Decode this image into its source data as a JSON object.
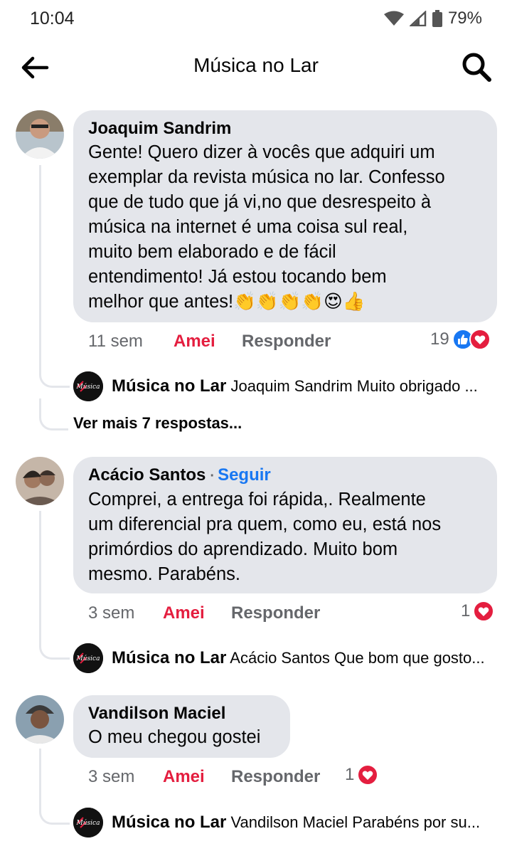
{
  "status": {
    "time": "10:04",
    "battery": "79%"
  },
  "header": {
    "title": "Música no Lar"
  },
  "comments": [
    {
      "author": "Joaquim Sandrim",
      "text": "Gente! Quero dizer à vocês que adquiri um\nexemplar da revista música no lar. Confesso\nque de tudo que já vi,no que desrespeito à\nmúsica na internet é uma coisa sul real,\nmuito bem elaborado e de fácil\nentendimento! Já estou tocando bem\nmelhor que antes!👏👏👏👏😍👍",
      "time": "11 sem",
      "like_label": "Amei",
      "reply_label": "Responder",
      "reactions": "19",
      "reply_author": "Música no Lar",
      "reply_preview": "Joaquim Sandrim Muito obrigado ...",
      "more_replies": "Ver mais 7 respostas..."
    },
    {
      "author": "Acácio Santos",
      "follow": "Seguir",
      "text": "Comprei, a entrega foi rápida,. Realmente\num diferencial pra quem, como eu, está nos\nprimórdios do aprendizado. Muito bom\nmesmo. Parabéns.",
      "time": "3 sem",
      "like_label": "Amei",
      "reply_label": "Responder",
      "reactions": "1",
      "reply_author": "Música no Lar",
      "reply_preview": "Acácio Santos Que bom que gosto..."
    },
    {
      "author": "Vandilson Maciel",
      "text": "O meu chegou gostei",
      "time": "3 sem",
      "like_label": "Amei",
      "reply_label": "Responder",
      "reactions": "1",
      "reply_author": "Música no Lar",
      "reply_preview": "Vandilson Maciel Parabéns por su..."
    }
  ],
  "colors": {
    "love": "#e41e3f",
    "link": "#1877f2",
    "bubble": "#e4e6eb"
  },
  "icons": {
    "back": "arrow-left-icon",
    "search": "search-icon",
    "like": "like-icon",
    "love": "heart-icon"
  }
}
